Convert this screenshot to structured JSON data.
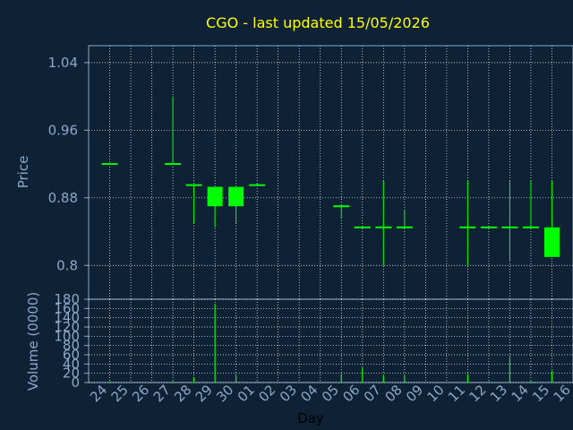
{
  "chart_data": [
    {
      "type": "candlestick",
      "title": "CGO - last updated 15/05/2026",
      "ylabel": "Price",
      "xlabel": "",
      "ylim": [
        0.76,
        1.06
      ],
      "yticks": [
        0.8,
        0.88,
        0.96,
        1.04
      ],
      "ytick_labels": [
        "0.8",
        "0.88",
        "0.96",
        "1.04"
      ],
      "grid": true,
      "x_categories": [
        "24",
        "25",
        "26",
        "27",
        "28",
        "29",
        "30",
        "01",
        "02",
        "03",
        "04",
        "05",
        "06",
        "07",
        "08",
        "09",
        "10",
        "11",
        "12",
        "13",
        "14",
        "15",
        "16"
      ],
      "candles": [
        {
          "day": "24",
          "open": 0.92,
          "high": 0.92,
          "low": 0.92,
          "close": 0.92
        },
        {
          "day": "27",
          "open": 0.92,
          "high": 1.0,
          "low": 0.92,
          "close": 0.92
        },
        {
          "day": "28",
          "open": 0.895,
          "high": 0.895,
          "low": 0.85,
          "close": 0.895
        },
        {
          "day": "29",
          "open": 0.893,
          "high": 0.893,
          "low": 0.845,
          "close": 0.87
        },
        {
          "day": "30",
          "open": 0.893,
          "high": 0.893,
          "low": 0.85,
          "close": 0.87
        },
        {
          "day": "01",
          "open": 0.895,
          "high": 0.897,
          "low": 0.895,
          "close": 0.895
        },
        {
          "day": "05",
          "open": 0.87,
          "high": 0.872,
          "low": 0.855,
          "close": 0.87
        },
        {
          "day": "06",
          "open": 0.845,
          "high": 0.845,
          "low": 0.845,
          "close": 0.845
        },
        {
          "day": "07",
          "open": 0.845,
          "high": 0.9,
          "low": 0.8,
          "close": 0.845
        },
        {
          "day": "08",
          "open": 0.845,
          "high": 0.865,
          "low": 0.845,
          "close": 0.845
        },
        {
          "day": "11",
          "open": 0.845,
          "high": 0.9,
          "low": 0.8,
          "close": 0.845
        },
        {
          "day": "12",
          "open": 0.845,
          "high": 0.845,
          "low": 0.845,
          "close": 0.845
        },
        {
          "day": "13",
          "open": 0.845,
          "high": 0.9,
          "low": 0.805,
          "close": 0.845
        },
        {
          "day": "14",
          "open": 0.845,
          "high": 0.9,
          "low": 0.845,
          "close": 0.845
        },
        {
          "day": "15",
          "open": 0.845,
          "high": 0.9,
          "low": 0.81,
          "close": 0.81
        }
      ],
      "colors": {
        "background": "#0f2235",
        "grid": "#ffffff",
        "axis": "#8aa8c8",
        "title": "#ffff00",
        "candle": "#00ff00"
      }
    },
    {
      "type": "bar",
      "ylabel": "Volume (0000)",
      "xlabel": "Day",
      "ylim": [
        0,
        180
      ],
      "yticks": [
        0,
        20,
        40,
        60,
        80,
        100,
        120,
        140,
        160,
        180
      ],
      "ytick_labels": [
        "0",
        "20",
        "40",
        "60",
        "80",
        "100",
        "120",
        "140",
        "160",
        "180"
      ],
      "categories": [
        "24",
        "25",
        "26",
        "27",
        "28",
        "29",
        "30",
        "01",
        "02",
        "03",
        "04",
        "05",
        "06",
        "07",
        "08",
        "09",
        "10",
        "11",
        "12",
        "13",
        "14",
        "15",
        "16"
      ],
      "values": [
        2,
        0,
        0,
        3,
        10,
        170,
        15,
        2,
        0,
        0,
        0,
        18,
        32,
        15,
        15,
        0,
        0,
        18,
        2,
        55,
        3,
        25,
        0
      ]
    }
  ]
}
